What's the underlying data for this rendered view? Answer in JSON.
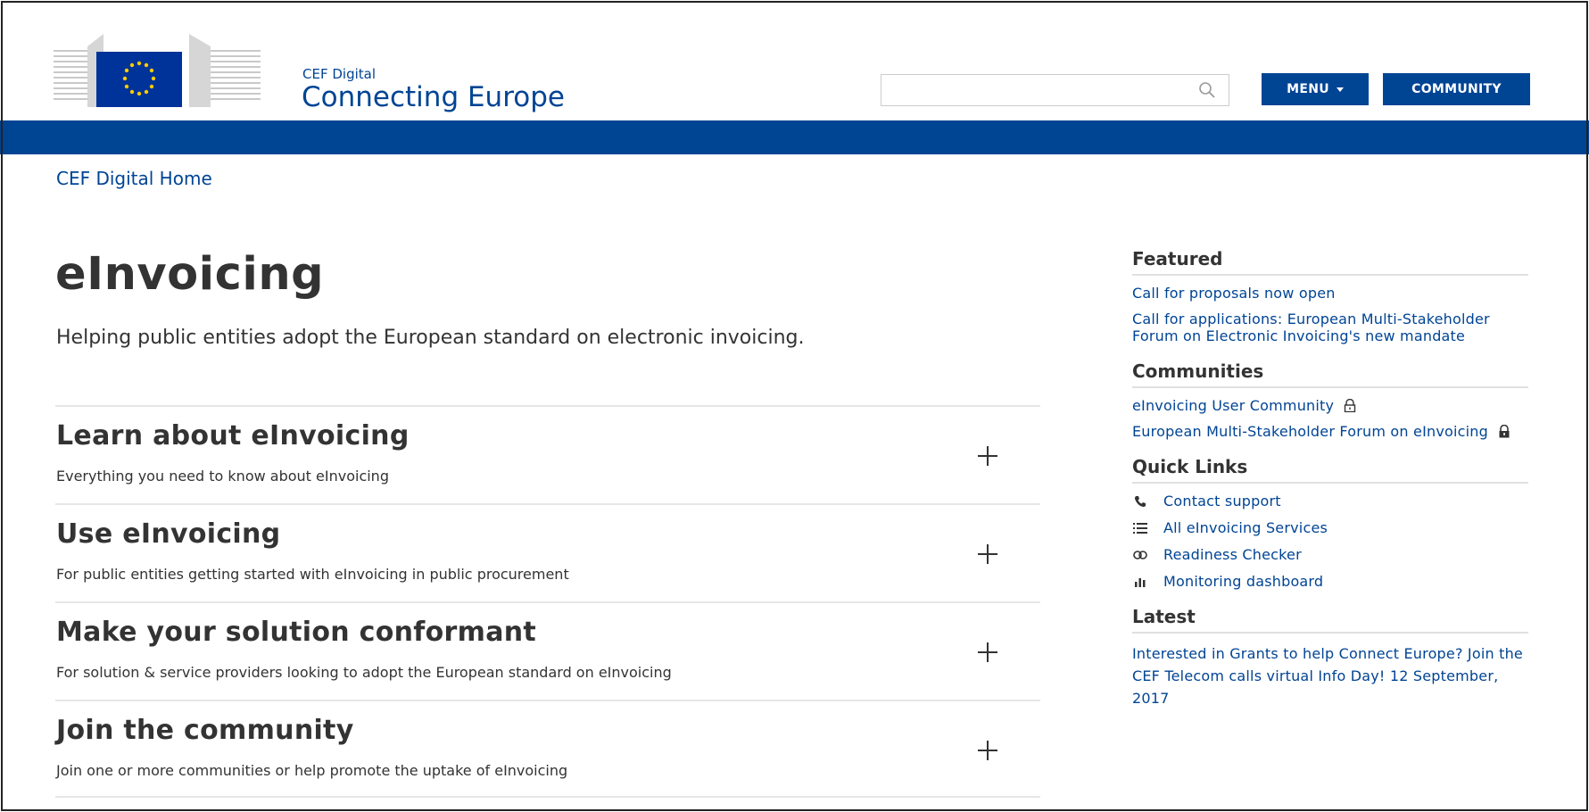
{
  "header": {
    "site_sub": "CEF Digital",
    "site_title": "Connecting Europe",
    "search": {
      "placeholder": "",
      "value": ""
    },
    "menu_label": "MENU",
    "community_label": "COMMUNITY",
    "icons": {
      "search": "search-icon",
      "menu": "caret-down-icon",
      "logo": "ec-logo"
    }
  },
  "colors": {
    "brand_blue": "#004494",
    "text": "#333333",
    "flag_blue": "#003399",
    "flag_star": "#FFCC00"
  },
  "breadcrumb": {
    "home_label": "CEF Digital Home"
  },
  "main": {
    "title": "eInvoicing",
    "lead": "Helping public entities adopt the European standard on electronic invoicing.",
    "accordion": [
      {
        "title": "Learn about eInvoicing",
        "desc": "Everything you need to know about eInvoicing"
      },
      {
        "title": "Use eInvoicing",
        "desc": "For public entities getting started with eInvoicing in public procurement"
      },
      {
        "title": "Make your solution conformant",
        "desc": "For solution & service providers looking to adopt the European standard on eInvoicing"
      },
      {
        "title": "Join the community",
        "desc": "Join one or more communities or help promote the uptake of eInvoicing"
      }
    ]
  },
  "sidebar": {
    "featured": {
      "heading": "Featured",
      "links": [
        "Call for proposals now open",
        "Call for applications: European Multi-Stakeholder Forum on Electronic Invoicing's new mandate"
      ]
    },
    "communities": {
      "heading": "Communities",
      "links": [
        {
          "label": "eInvoicing User Community",
          "icon": "lock-open-icon"
        },
        {
          "label": "European Multi-Stakeholder Forum on eInvoicing",
          "icon": "lock-icon"
        }
      ]
    },
    "quick_links": {
      "heading": "Quick Links",
      "links": [
        {
          "label": "Contact support",
          "icon": "phone-icon"
        },
        {
          "label": "All eInvoicing Services",
          "icon": "list-icon"
        },
        {
          "label": "Readiness Checker",
          "icon": "link-icon"
        },
        {
          "label": "Monitoring dashboard",
          "icon": "bar-chart-icon"
        }
      ]
    },
    "latest": {
      "heading": "Latest",
      "links": [
        "Interested in Grants to help Connect Europe? Join the CEF Telecom calls virtual Info Day! 12 September, 2017"
      ]
    }
  }
}
